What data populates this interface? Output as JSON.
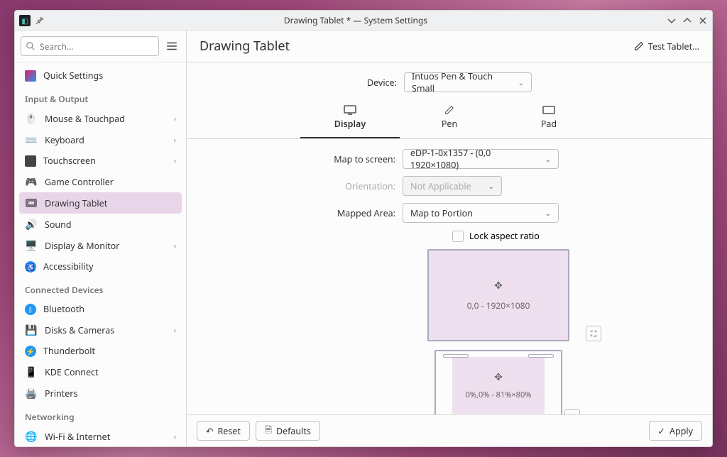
{
  "titlebar": {
    "title": "Drawing Tablet * — System Settings"
  },
  "search": {
    "placeholder": "Search..."
  },
  "sidebar": {
    "quick": "Quick Settings",
    "headers": {
      "io": "Input & Output",
      "connected": "Connected Devices",
      "net": "Networking"
    },
    "items": {
      "mouse": "Mouse & Touchpad",
      "keyboard": "Keyboard",
      "touchscreen": "Touchscreen",
      "gamectl": "Game Controller",
      "tablet": "Drawing Tablet",
      "sound": "Sound",
      "display": "Display & Monitor",
      "a11y": "Accessibility",
      "bt": "Bluetooth",
      "disks": "Disks & Cameras",
      "tb": "Thunderbolt",
      "kde": "KDE Connect",
      "printers": "Printers",
      "wifi": "Wi-Fi & Internet"
    }
  },
  "header": {
    "title": "Drawing Tablet",
    "test": "Test Tablet…"
  },
  "device": {
    "label": "Device:",
    "value": "Intuos Pen & Touch Small"
  },
  "tabs": {
    "display": "Display",
    "pen": "Pen",
    "pad": "Pad"
  },
  "map": {
    "screen_label": "Map to screen:",
    "screen_value": "eDP-1-0x1357 - (0,0 1920×1080)",
    "orient_label": "Orientation:",
    "orient_value": "Not Applicable",
    "area_label": "Mapped Area:",
    "area_value": "Map to Portion",
    "lock": "Lock aspect ratio",
    "screen_box": "0,0 - 1920×1080",
    "tablet_box": "0%,0% - 81%×80%"
  },
  "footer": {
    "reset": "Reset",
    "defaults": "Defaults",
    "apply": "Apply"
  }
}
